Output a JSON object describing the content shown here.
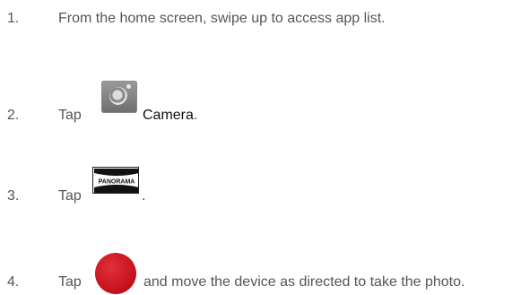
{
  "steps": [
    {
      "number": "1.",
      "text": "From the home screen, swipe up to access app list."
    },
    {
      "number": "2.",
      "tap": "Tap",
      "icon": "camera-app-icon",
      "label": "Camera",
      "trailing": "."
    },
    {
      "number": "3.",
      "tap": "Tap",
      "icon": "panorama-mode-icon",
      "icon_text": "PANORAMA",
      "trailing": "."
    },
    {
      "number": "4.",
      "tap": "Tap",
      "icon": "shutter-button-icon",
      "icon_color": "#c8141f",
      "text": "and move the device as directed to take the photo."
    }
  ]
}
